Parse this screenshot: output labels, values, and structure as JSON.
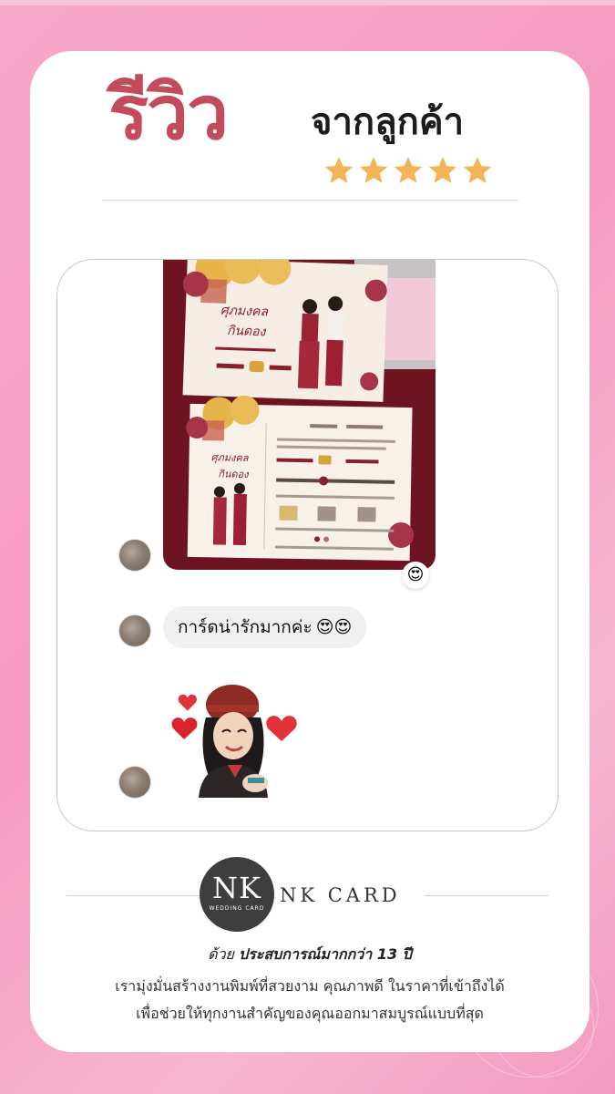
{
  "header": {
    "title_big": "รีวิว",
    "title_small": "จากลูกค้า",
    "rating_stars": 5,
    "star_color": "#f2b457",
    "title_color": "#c24b5c"
  },
  "chat": {
    "reaction_emoji": "😍",
    "message_text": "การ์ดน่ารักมากค่ะ",
    "message_emojis": "😍😍"
  },
  "footer": {
    "logo_initials": "NK",
    "logo_subtext": "WEDDING CARD",
    "brand_name": "NK CARD",
    "tagline_prefix": "ด้วย ",
    "tagline_bold": "ประสบการณ์มากกว่า 13 ปี",
    "description_line1": "เรามุ่งมั่นสร้างงานพิมพ์ที่สวยงาม คุณภาพดี ในราคาที่เข้าถึงได้",
    "description_line2": "เพื่อช่วยให้ทุกงานสำคัญของคุณออกมาสมบูรณ์แบบที่สุด"
  },
  "colors": {
    "background_pink": "#f59bc0",
    "card_white": "#ffffff"
  }
}
